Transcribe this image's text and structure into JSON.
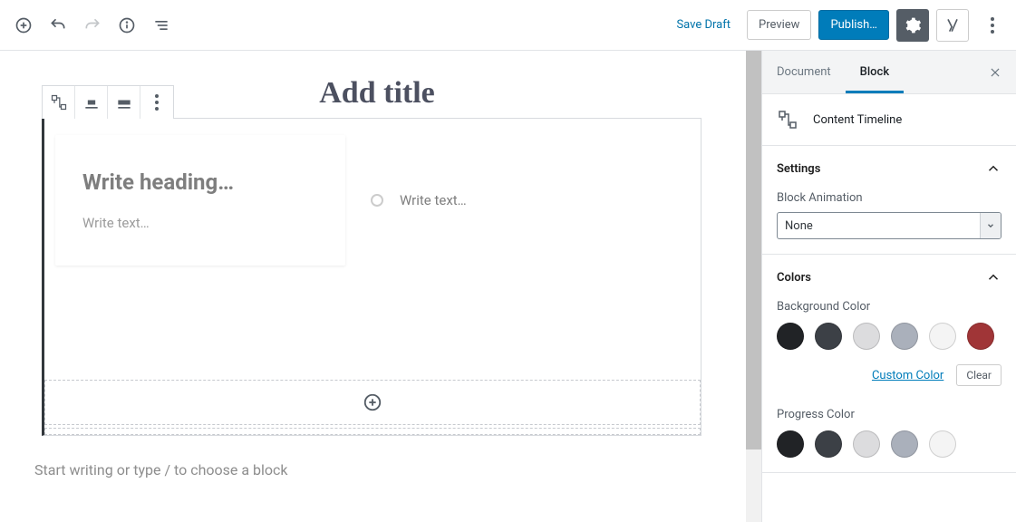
{
  "topbar": {
    "save_draft": "Save Draft",
    "preview": "Preview",
    "publish": "Publish…"
  },
  "editor": {
    "title_placeholder": "Add title",
    "timeline": {
      "heading_placeholder": "Write heading…",
      "text_placeholder": "Write text…",
      "side_text_placeholder": "Write text…"
    },
    "default_appender": "Start writing or type / to choose a block"
  },
  "sidebar": {
    "tabs": {
      "document": "Document",
      "block": "Block"
    },
    "block_name": "Content Timeline",
    "panels": {
      "settings": {
        "title": "Settings",
        "block_animation_label": "Block Animation",
        "block_animation_value": "None"
      },
      "colors": {
        "title": "Colors",
        "background_label": "Background Color",
        "progress_label": "Progress Color",
        "custom_color": "Custom Color",
        "clear": "Clear",
        "swatches": [
          "#212326",
          "#3c4046",
          "#dcdcde",
          "#aab0bb",
          "#f4f4f4",
          "#a03537"
        ]
      }
    }
  }
}
